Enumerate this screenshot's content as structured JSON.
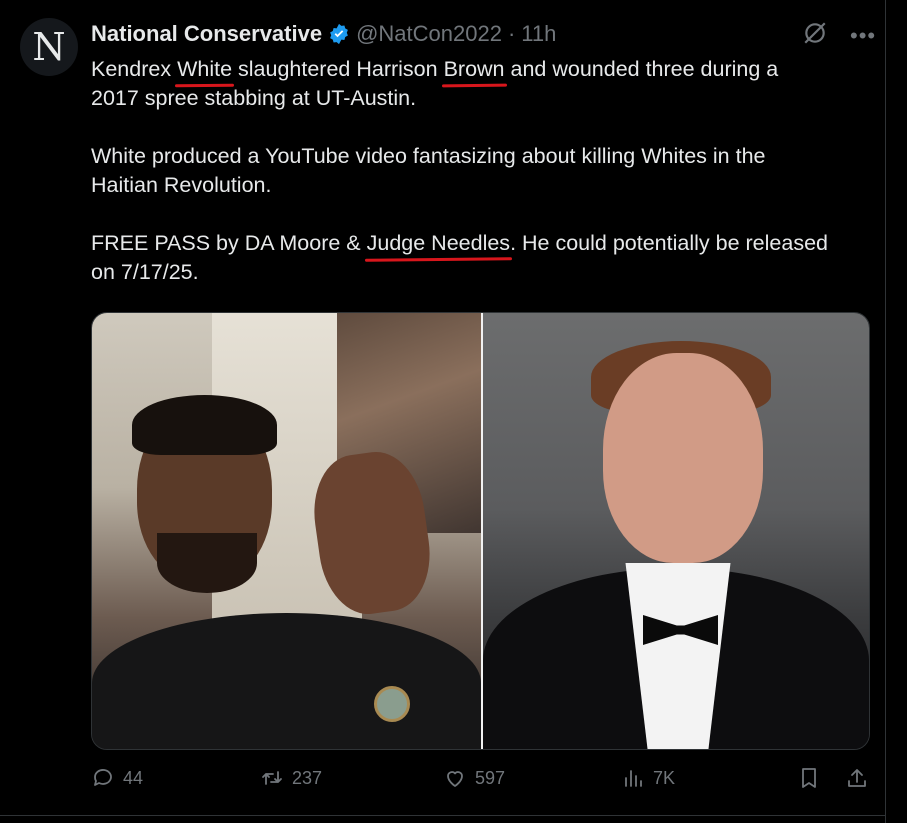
{
  "author": {
    "avatar_letter": "N",
    "name": "National Conservative",
    "handle": "@NatCon2022",
    "separator": "·",
    "time": "11h"
  },
  "tweet": {
    "line1_a": "Kendrex ",
    "line1_u1": "White",
    "line1_b": " slaughtered Harrison ",
    "line1_u2": "Brown",
    "line1_c": " and wounded three during a",
    "line2": "2017 spree stabbing at UT-Austin.",
    "line3": "White produced a YouTube video fantasizing about killing Whites in the",
    "line4": "Haitian Revolution.",
    "line5_a": "FREE PASS by DA Moore & ",
    "line5_u": "Judge Needles",
    "line5_b": ". He could potentially be released",
    "line6": "on 7/17/25."
  },
  "actions": {
    "replies": "44",
    "reposts": "237",
    "likes": "597",
    "views": "7K"
  },
  "colors": {
    "background": "#000000",
    "text": "#e7e9ea",
    "muted": "#71767b",
    "verified": "#1d9bf0",
    "underline": "#d8161c"
  }
}
